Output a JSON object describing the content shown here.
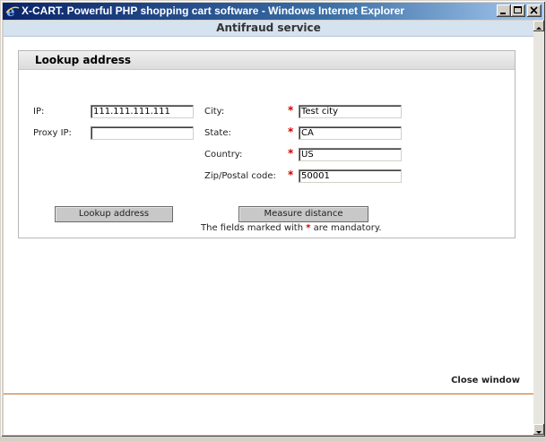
{
  "window": {
    "title": "X-CART. Powerful PHP shopping cart software - Windows Internet Explorer"
  },
  "page": {
    "header": "Antifraud service",
    "panel_title": "Lookup address",
    "fields": {
      "ip_label": "IP:",
      "ip_value": "111.111.111.111",
      "proxy_label": "Proxy IP:",
      "proxy_value": "",
      "city_label": "City:",
      "city_value": "Test city",
      "state_label": "State:",
      "state_value": "CA",
      "country_label": "Country:",
      "country_value": "US",
      "zip_label": "Zip/Postal code:",
      "zip_value": "50001"
    },
    "required_mark": "*",
    "buttons": {
      "lookup": "Lookup address",
      "measure": "Measure distance"
    },
    "note_before": "The fields marked with ",
    "note_after": " are mandatory.",
    "close_window": "Close window"
  },
  "colors": {
    "title_bar_start": "#0a246a",
    "header_bg": "#d5e2ef",
    "required": "#cc0000",
    "footer_line": "#c86a1e"
  }
}
